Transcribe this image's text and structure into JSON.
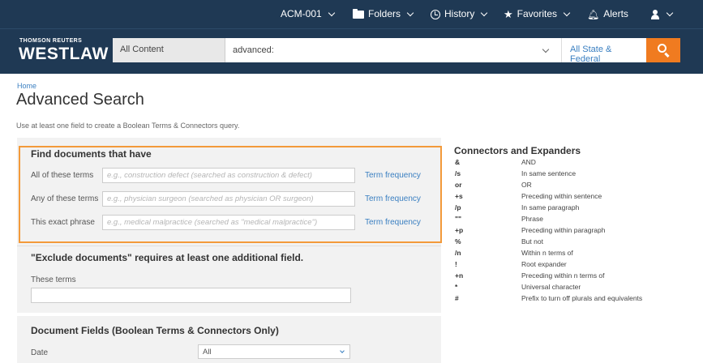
{
  "topnav": {
    "client_id": "ACM-001",
    "folders": "Folders",
    "history": "History",
    "favorites": "Favorites",
    "alerts": "Alerts"
  },
  "header": {
    "logo_line1": "THOMSON REUTERS",
    "logo_line2": "WESTLAW",
    "scope": "All Content",
    "search_value": "advanced:",
    "jurisdiction": "All State & Federal"
  },
  "page": {
    "breadcrumb": "Home",
    "title": "Advanced Search",
    "instruction": "Use at least one field to create a Boolean Terms & Connectors query."
  },
  "find_section": {
    "heading": "Find documents that have",
    "rows": [
      {
        "label": "All of these terms",
        "placeholder": "e.g., construction defect (searched as construction & defect)",
        "link": "Term frequency"
      },
      {
        "label": "Any of these terms",
        "placeholder": "e.g., physician surgeon (searched as physician OR surgeon)",
        "link": "Term frequency"
      },
      {
        "label": "This exact phrase",
        "placeholder": "e.g., medical malpractice (searched as \"medical malpractice\")",
        "link": "Term frequency"
      }
    ]
  },
  "exclude_section": {
    "heading": "\"Exclude documents\" requires at least one additional field.",
    "label": "These terms"
  },
  "fields_section": {
    "heading": "Document Fields (Boolean Terms & Connectors Only)",
    "date_label": "Date",
    "date_value": "All"
  },
  "connectors": {
    "title": "Connectors and Expanders",
    "items": [
      {
        "symbol": "&",
        "description": "AND"
      },
      {
        "symbol": "/s",
        "description": "In same sentence"
      },
      {
        "symbol": "or",
        "description": "OR"
      },
      {
        "symbol": "+s",
        "description": "Preceding within sentence"
      },
      {
        "symbol": "/p",
        "description": "In same paragraph"
      },
      {
        "symbol": "\"\"",
        "description": "Phrase"
      },
      {
        "symbol": "+p",
        "description": "Preceding within paragraph"
      },
      {
        "symbol": "%",
        "description": "But not"
      },
      {
        "symbol": "/n",
        "description": "Within n terms of"
      },
      {
        "symbol": "!",
        "description": "Root expander"
      },
      {
        "symbol": "+n",
        "description": "Preceding within n terms of"
      },
      {
        "symbol": "*",
        "description": "Universal character"
      },
      {
        "symbol": "#",
        "description": "Prefix to turn off plurals and equivalents"
      }
    ]
  },
  "colors": {
    "nav_bg": "#1f3954",
    "accent_orange": "#f07b20",
    "link_blue": "#3a7fc1"
  }
}
